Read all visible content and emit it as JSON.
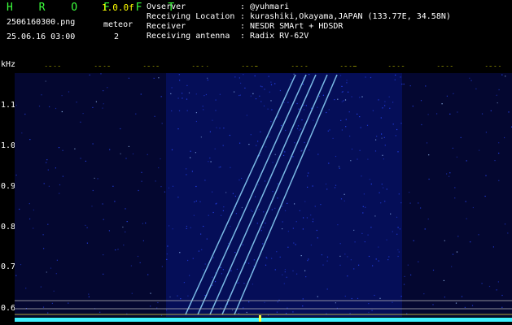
{
  "header": {
    "title": "H R O F F T",
    "version": "1.0.0f",
    "filename": "2506160300.png",
    "datetime": "25.06.16 03:00",
    "meteor_label": "meteor",
    "meteor_count": "2"
  },
  "info": [
    {
      "label": "Ovserver",
      "value": ": @yuhmari"
    },
    {
      "label": "Receiving Location",
      "value": ": kurashiki,Okayama,JAPAN (133.77E, 34.58N)"
    },
    {
      "label": "Receiver",
      "value": ": NESDR SMArt + HDSDR"
    },
    {
      "label": "Receiving antenna",
      "value": ": Radix RV-62V"
    }
  ],
  "axis": {
    "unit": "kHz",
    "time_labels": [
      "0301",
      "0302",
      "0303",
      "0304",
      "0305",
      "0306",
      "0307",
      "0308",
      "0309",
      "0310"
    ],
    "freq_labels": [
      "1.1",
      "1.0",
      "0.9",
      "0.8",
      "0.7",
      "0.6"
    ]
  },
  "colors": {
    "background": "#000000",
    "noise": "#0a1aa0",
    "signal": "#8fd8ff",
    "baseline": "#3ff0ff",
    "header_green": "#3cff3c",
    "tick_yellow": "#ffff00"
  }
}
